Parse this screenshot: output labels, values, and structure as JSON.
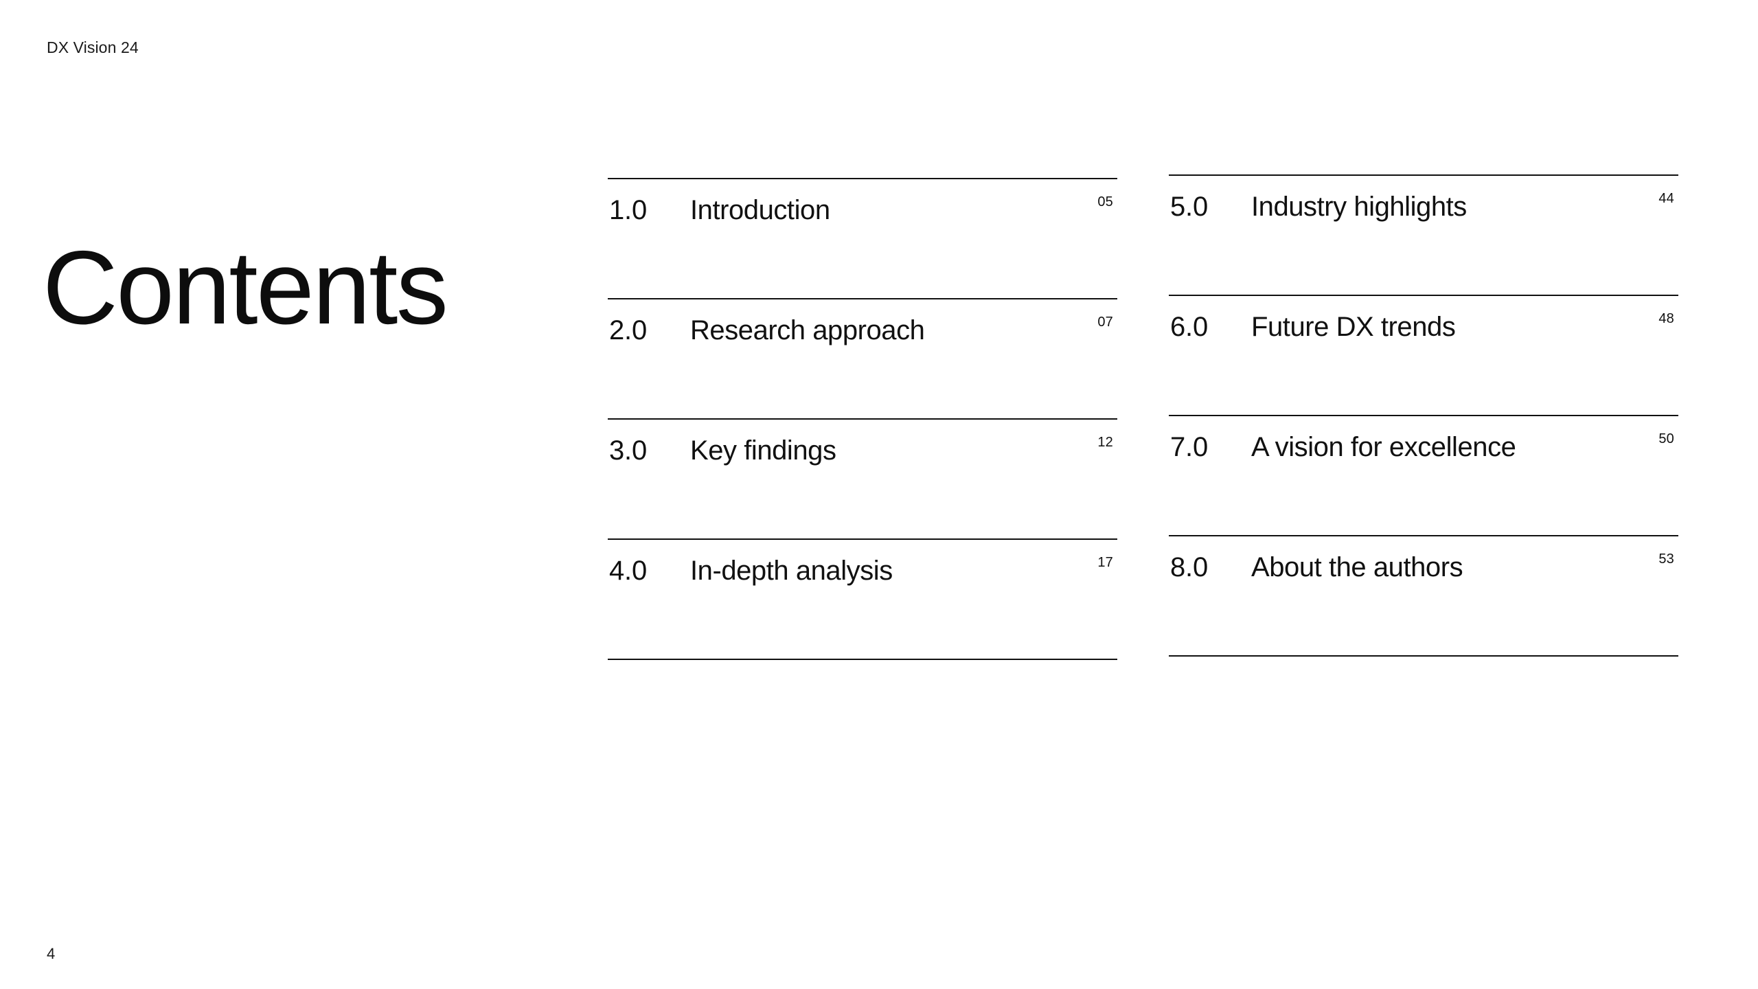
{
  "document": {
    "running_header": "DX Vision 24",
    "page_title": "Contents",
    "folio": "4",
    "background_color": "#ffffff",
    "text_color": "#111111",
    "rule_color": "#111111"
  },
  "toc": {
    "columns": [
      {
        "name": "left-column",
        "entries": [
          {
            "number": "1.0",
            "label": "Introduction",
            "page": "05"
          },
          {
            "number": "2.0",
            "label": "Research approach",
            "page": "07"
          },
          {
            "number": "3.0",
            "label": "Key findings",
            "page": "12"
          },
          {
            "number": "4.0",
            "label": "In-depth analysis",
            "page": "17"
          }
        ]
      },
      {
        "name": "right-column",
        "entries": [
          {
            "number": "5.0",
            "label": "Industry highlights",
            "page": "44"
          },
          {
            "number": "6.0",
            "label": "Future DX trends",
            "page": "48"
          },
          {
            "number": "7.0",
            "label": "A vision for excellence",
            "page": "50"
          },
          {
            "number": "8.0",
            "label": "About the authors",
            "page": "53"
          }
        ]
      }
    ]
  }
}
